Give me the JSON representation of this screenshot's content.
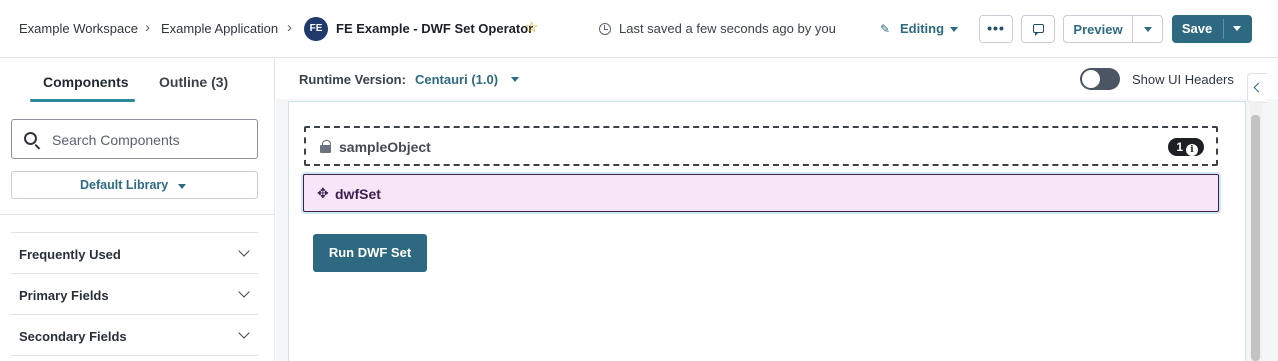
{
  "header": {
    "breadcrumbs": [
      "Example Workspace",
      "Example Application"
    ],
    "separator": ">",
    "app_avatar": "FE",
    "app_title": "FE Example - DWF Set Operator",
    "favorite_icon": "star-icon",
    "save_status": "Last saved a few seconds ago by you",
    "mode": "Editing",
    "preview_label": "Preview",
    "save_label": "Save",
    "more_icon": "more-dots-icon",
    "comment_icon": "comment-icon"
  },
  "sidebar": {
    "tabs": [
      {
        "label": "Components",
        "active": true
      },
      {
        "label": "Outline (3)",
        "active": false
      }
    ],
    "search": {
      "placeholder": "Search Components",
      "value": ""
    },
    "library": "Default Library",
    "sections": [
      {
        "label": "Frequently Used"
      },
      {
        "label": "Primary Fields"
      },
      {
        "label": "Secondary Fields"
      }
    ]
  },
  "canvas_toolbar": {
    "runtime_label": "Runtime Version:",
    "runtime_value": "Centauri (1.0)",
    "toggle_label": "Show UI Headers",
    "toggle_on": false
  },
  "canvas": {
    "sample_object": {
      "label": "sampleObject",
      "count": "1"
    },
    "dwf_set": {
      "label": "dwfSet"
    },
    "run_button": "Run DWF Set"
  },
  "colors": {
    "accent": "#2d6a81",
    "selected_bg": "#f8e6f8",
    "selected_text": "#3a1f4f",
    "tab_underline": "#2d8a99"
  }
}
